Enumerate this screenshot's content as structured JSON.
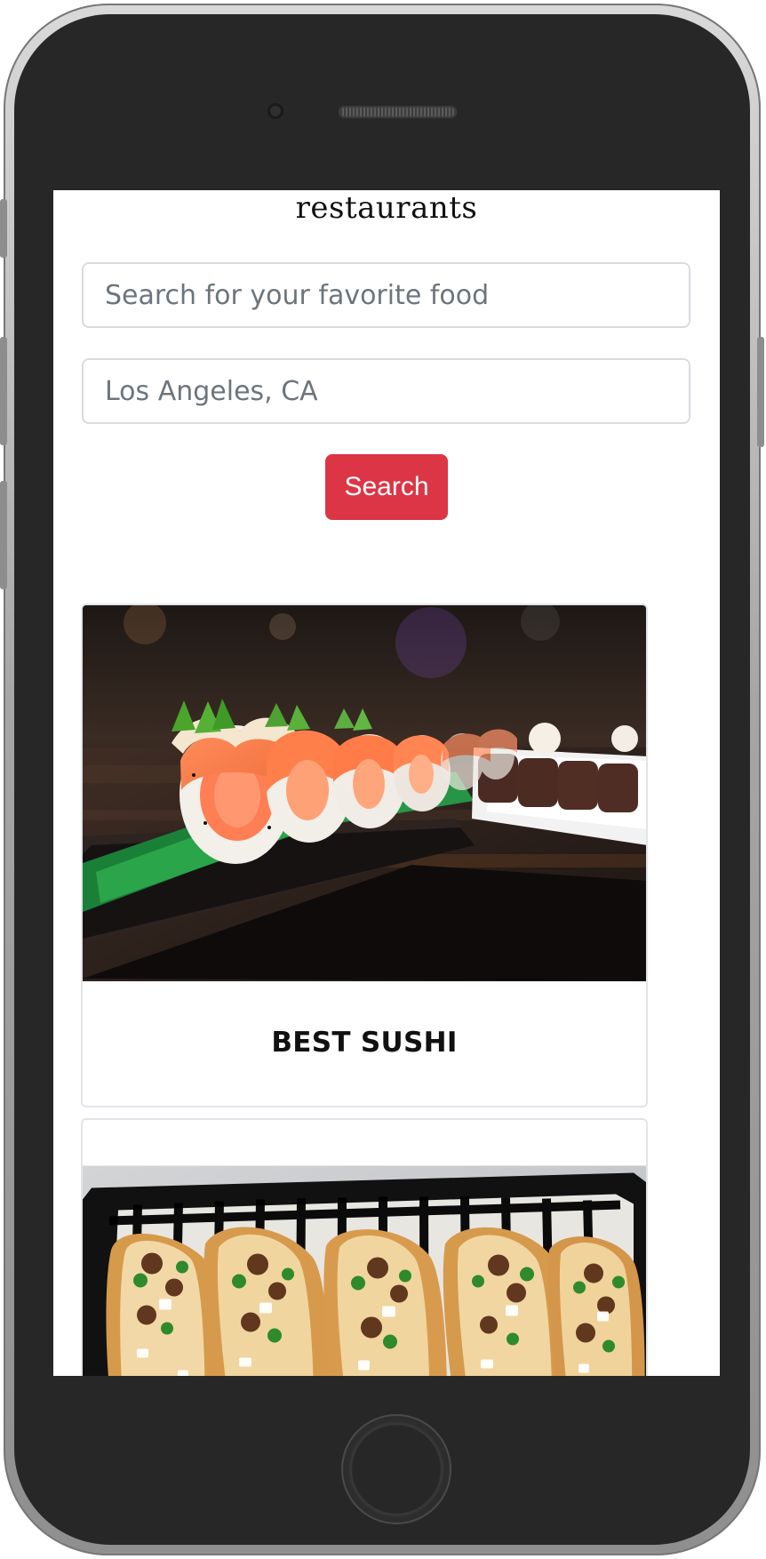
{
  "header": {
    "brand": "restaurants"
  },
  "search": {
    "food_placeholder": "Search for your favorite food",
    "location_placeholder": "Los Angeles, CA",
    "button_label": "Search"
  },
  "cards": [
    {
      "title": "BEST SUSHI",
      "image": "sushi-photo"
    },
    {
      "title": "",
      "image": "tacos-photo"
    }
  ],
  "colors": {
    "accent": "#dc3545",
    "device": "#272727"
  }
}
